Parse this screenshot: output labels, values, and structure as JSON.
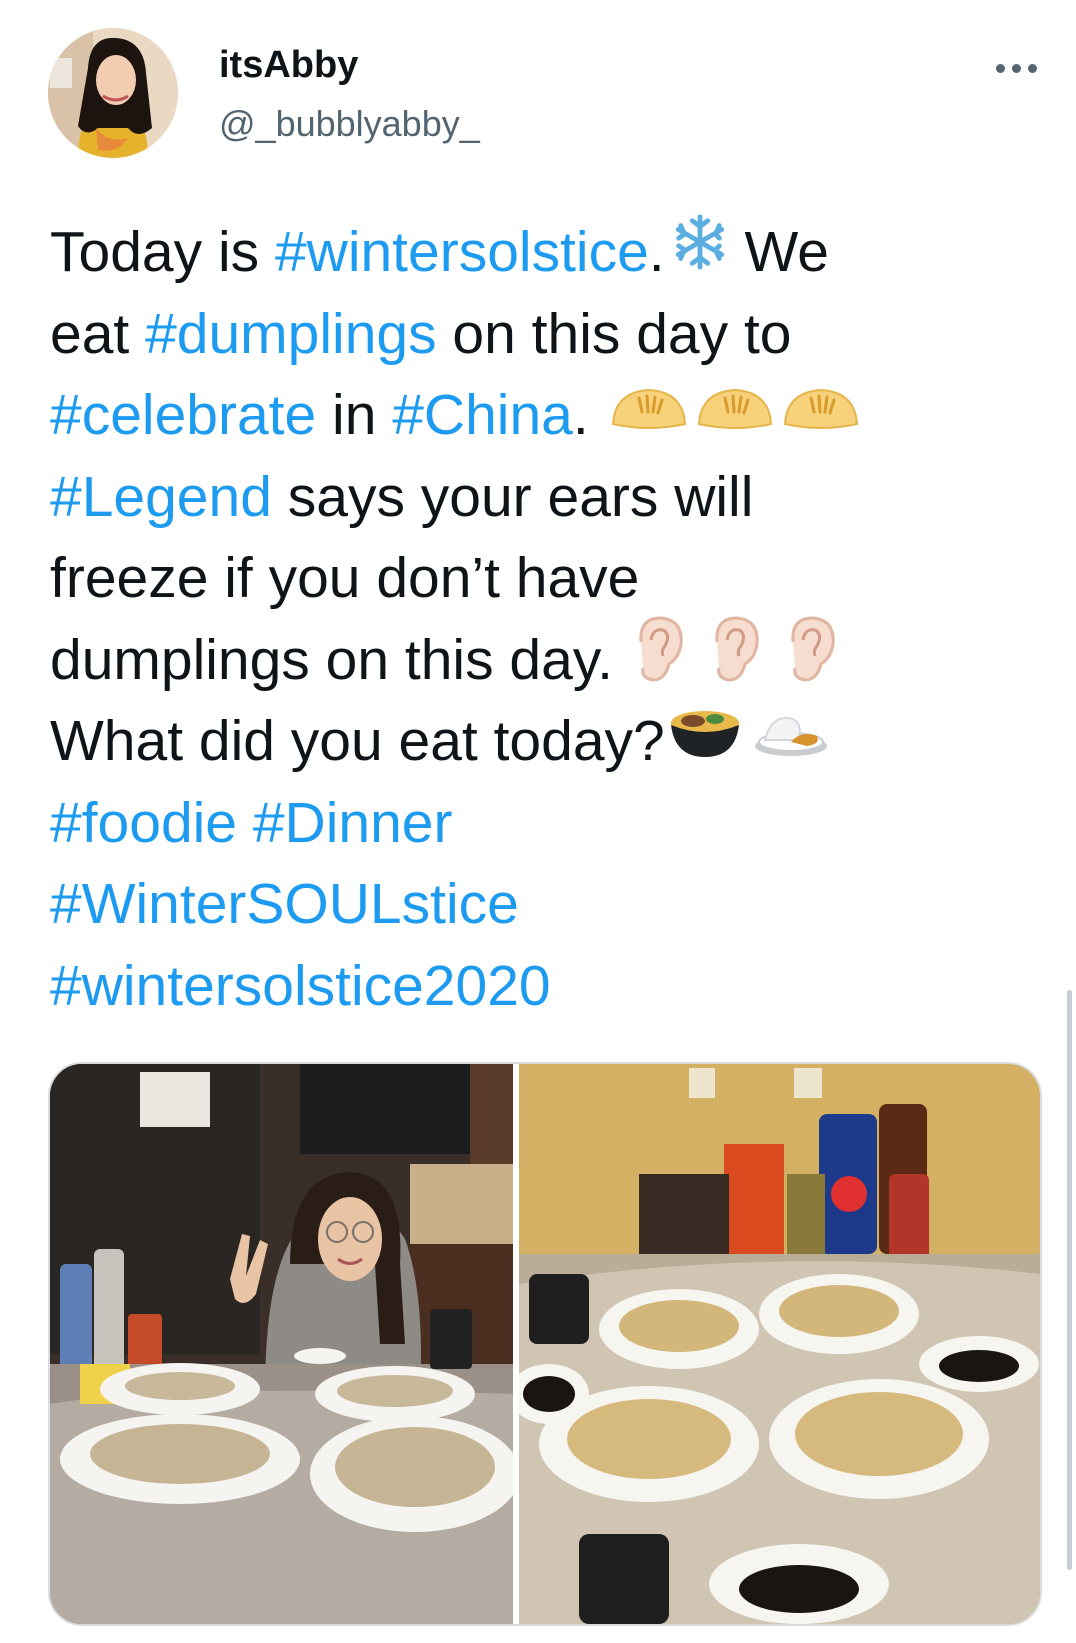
{
  "author": {
    "name": "itsAbby",
    "handle": "@_bubblyabby_"
  },
  "tweet": {
    "l1": {
      "a": "Today is ",
      "b": "#wintersolstice",
      "c": ".",
      "d": " We"
    },
    "l2": {
      "a": "eat ",
      "b": "#dumplings",
      "c": " on this day to"
    },
    "l3": {
      "a": "#celebrate",
      "b": " in ",
      "c": "#China",
      "d": "."
    },
    "l4": {
      "a": "#Legend",
      "b": " says your ears will"
    },
    "l5": {
      "a": "freeze if you don’t have"
    },
    "l6": {
      "a": "dumplings on this day."
    },
    "l7": {
      "a": "What did you eat today?"
    },
    "l8": {
      "a": "#foodie",
      "b": " ",
      "c": "#Dinner"
    },
    "l9": {
      "a": "#WinterSOULstice"
    },
    "l10": {
      "a": "#wintersolstice2020"
    }
  },
  "icons": [
    "snowflake-icon",
    "dumpling-icon",
    "ear-icon",
    "stew-icon",
    "curry-rice-icon",
    "more-options-icon"
  ],
  "colors": {
    "hashtag": "#1d9bf0",
    "text": "#0f1419",
    "secondary": "#536471"
  }
}
